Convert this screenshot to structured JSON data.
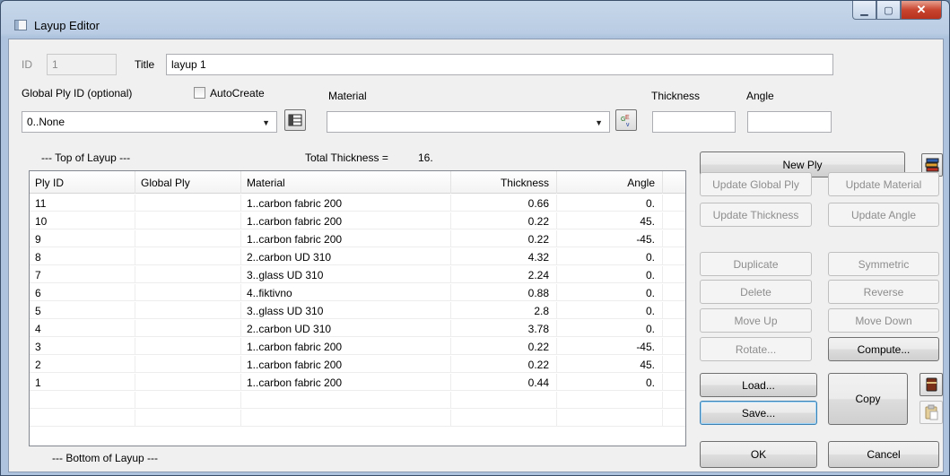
{
  "window": {
    "title": "Layup Editor"
  },
  "form": {
    "id_label": "ID",
    "id_value": "1",
    "title_label": "Title",
    "title_value": "layup 1",
    "global_ply_label": "Global Ply ID (optional)",
    "global_ply_value": "0..None",
    "autocreate_label": "AutoCreate",
    "material_label": "Material",
    "material_value": "",
    "thickness_label": "Thickness",
    "thickness_value": "",
    "angle_label": "Angle",
    "angle_value": ""
  },
  "layup": {
    "top_label": "--- Top of Layup ---",
    "total_thickness_label": "Total Thickness =",
    "total_thickness_value": "16.",
    "bottom_label": "--- Bottom of Layup ---",
    "columns": [
      "Ply ID",
      "Global Ply",
      "Material",
      "Thickness",
      "Angle"
    ],
    "rows": [
      {
        "ply_id": "11",
        "global_ply": "",
        "material": "1..carbon fabric 200",
        "thickness": "0.66",
        "angle": "0."
      },
      {
        "ply_id": "10",
        "global_ply": "",
        "material": "1..carbon fabric 200",
        "thickness": "0.22",
        "angle": "45."
      },
      {
        "ply_id": "9",
        "global_ply": "",
        "material": "1..carbon fabric 200",
        "thickness": "0.22",
        "angle": "-45."
      },
      {
        "ply_id": "8",
        "global_ply": "",
        "material": "2..carbon UD 310",
        "thickness": "4.32",
        "angle": "0."
      },
      {
        "ply_id": "7",
        "global_ply": "",
        "material": "3..glass UD 310",
        "thickness": "2.24",
        "angle": "0."
      },
      {
        "ply_id": "6",
        "global_ply": "",
        "material": "4..fiktivno",
        "thickness": "0.88",
        "angle": "0."
      },
      {
        "ply_id": "5",
        "global_ply": "",
        "material": "3..glass UD 310",
        "thickness": "2.8",
        "angle": "0."
      },
      {
        "ply_id": "4",
        "global_ply": "",
        "material": "2..carbon UD 310",
        "thickness": "3.78",
        "angle": "0."
      },
      {
        "ply_id": "3",
        "global_ply": "",
        "material": "1..carbon fabric 200",
        "thickness": "0.22",
        "angle": "-45."
      },
      {
        "ply_id": "2",
        "global_ply": "",
        "material": "1..carbon fabric 200",
        "thickness": "0.22",
        "angle": "45."
      },
      {
        "ply_id": "1",
        "global_ply": "",
        "material": "1..carbon fabric 200",
        "thickness": "0.44",
        "angle": "0."
      }
    ]
  },
  "buttons": {
    "new_ply": "New Ply",
    "update_global_ply": "Update Global Ply",
    "update_material": "Update Material",
    "update_thickness": "Update Thickness",
    "update_angle": "Update Angle",
    "duplicate": "Duplicate",
    "symmetric": "Symmetric",
    "delete": "Delete",
    "reverse": "Reverse",
    "move_up": "Move Up",
    "move_down": "Move Down",
    "rotate": "Rotate...",
    "compute": "Compute...",
    "load": "Load...",
    "save": "Save...",
    "copy": "Copy",
    "ok": "OK",
    "cancel": "Cancel"
  }
}
